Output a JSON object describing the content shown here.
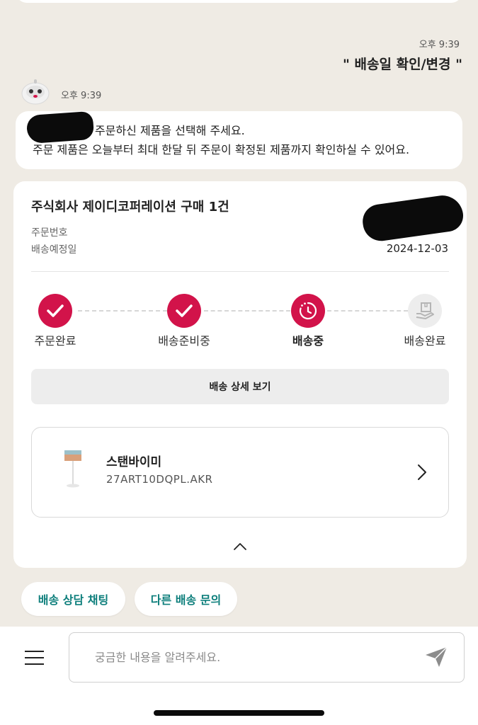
{
  "chat": {
    "user_message": {
      "time": "오후 9:39",
      "text": "\" 배송일 확인/변경 \""
    },
    "bot_message": {
      "time": "오후 9:39",
      "line1": "주문하신 제품을 선택해 주세요.",
      "line2": "주문 제품은 오늘부터 최대 한달 뒤 주문이 확정된 제품까지 확인하실 수 있어요."
    }
  },
  "order_card": {
    "title": "주식회사 제이디코퍼레이션 구매 1건",
    "order_number_label": "주문번호",
    "delivery_date_label": "배송예정일",
    "delivery_date_value": "2024-12-03",
    "steps": [
      {
        "label": "주문완료",
        "state": "done"
      },
      {
        "label": "배송준비중",
        "state": "done"
      },
      {
        "label": "배송중",
        "state": "current"
      },
      {
        "label": "배송완료",
        "state": "pending"
      }
    ],
    "detail_button_label": "배송 상세 보기",
    "product": {
      "name": "스탠바이미",
      "model": "27ART10DQPL.AKR"
    }
  },
  "quick_replies": [
    "배송 상담 채팅",
    "다른 배송 문의"
  ],
  "input": {
    "placeholder": "궁금한 내용을 알려주세요."
  },
  "colors": {
    "background": "#efebe4",
    "accent_red": "#d2134a",
    "chip_text": "#0e7f7c"
  },
  "icons": [
    "robot-avatar-icon",
    "check-icon",
    "delivery-progress-icon",
    "package-hand-icon",
    "chevron-right-icon",
    "chevron-up-icon",
    "menu-icon",
    "send-icon"
  ]
}
